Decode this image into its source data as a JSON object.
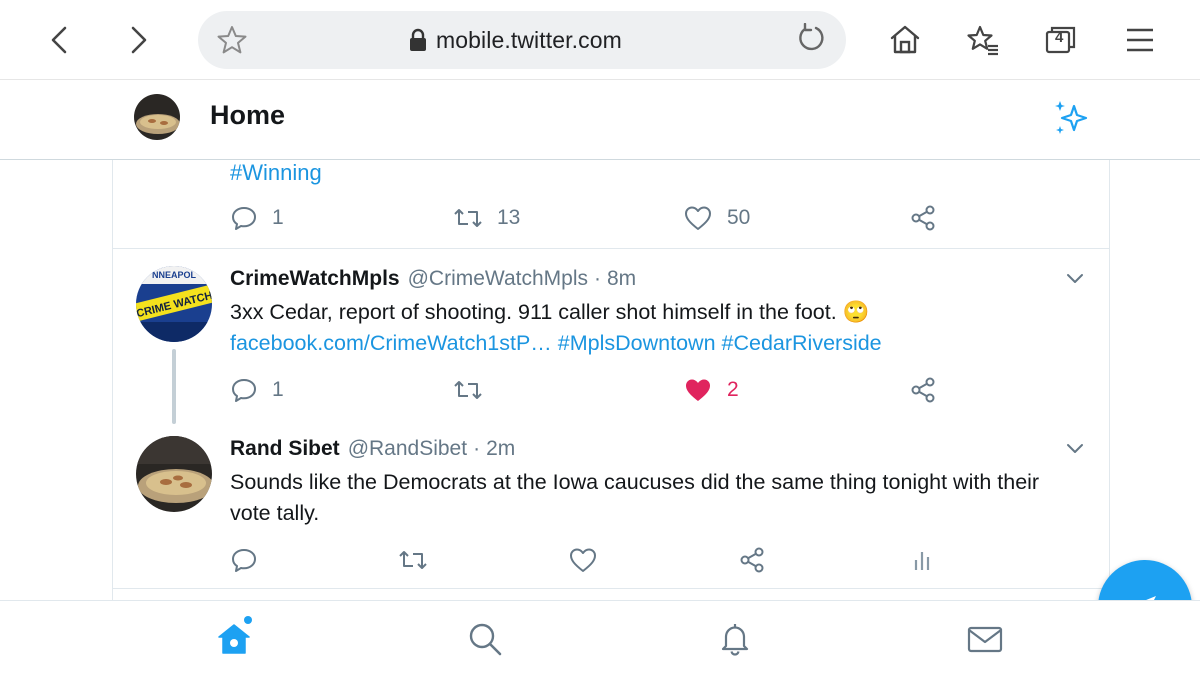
{
  "browser": {
    "url": "mobile.twitter.com",
    "tab_count": "4"
  },
  "header": {
    "title": "Home"
  },
  "tweet_prev": {
    "hashtag": "#Winning",
    "replies": "1",
    "retweets": "13",
    "likes": "50"
  },
  "tweet1": {
    "name": "CrimeWatchMpls",
    "handle": "@CrimeWatchMpls",
    "time": "8m",
    "text": "3xx Cedar, report of shooting. 911 caller shot himself in the foot. 🙄",
    "link1": "facebook.com/CrimeWatch1stP…",
    "link2": "#MplsDowntown",
    "link3": "#CedarRiverside",
    "replies": "1",
    "likes": "2",
    "avatar_text_top": "NNEAPOL",
    "avatar_text_mid": "CRIME WATCH"
  },
  "tweet2": {
    "name": "Rand Sibet",
    "handle": "@RandSibet",
    "time": "2m",
    "text": "Sounds like the Democrats at the Iowa caucuses did the same thing tonight with their vote tally."
  },
  "colors": {
    "accent": "#1da1f2",
    "link": "#1b95e0",
    "like": "#e0245e",
    "muted": "#657786"
  },
  "icons": {
    "nav_home": "home-icon",
    "nav_search": "search-icon",
    "nav_notifications": "bell-icon",
    "nav_messages": "mail-icon",
    "fab": "compose-icon"
  }
}
